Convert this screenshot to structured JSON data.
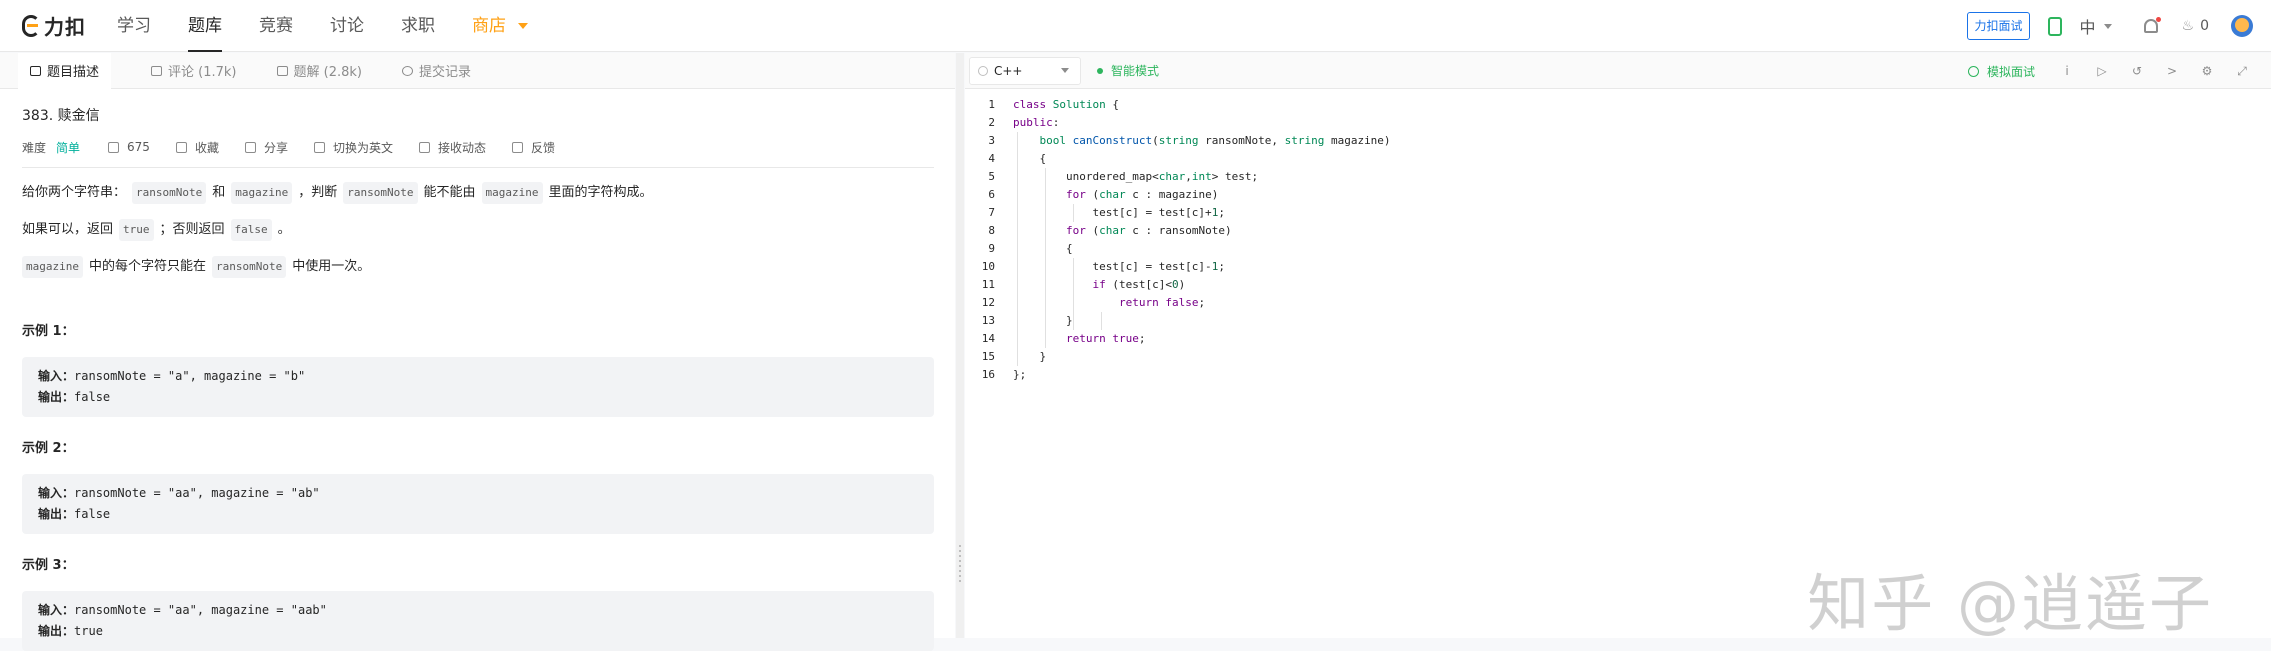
{
  "nav": {
    "logo_text": "力扣",
    "items": [
      "学习",
      "题库",
      "竞赛",
      "讨论",
      "求职"
    ],
    "shop": "商店",
    "interview_button": "力扣面试",
    "language": "中",
    "fire_count": "0"
  },
  "left": {
    "tabs": [
      "题目描述",
      "评论 (1.7k)",
      "题解 (2.8k)",
      "提交记录"
    ],
    "title": "383. 赎金信",
    "difficulty_label": "难度",
    "difficulty": "简单",
    "likes": "675",
    "collect": "收藏",
    "share": "分享",
    "switch_en": "切换为英文",
    "subscribe": "接收动态",
    "feedback": "反馈",
    "desc1": {
      "a": "给你两个字符串：",
      "c1": "ransomNote",
      "b": "和",
      "c2": "magazine",
      "c": "，判断",
      "c3": "ransomNote",
      "d": "能不能由",
      "c4": "magazine",
      "e": "里面的字符构成。"
    },
    "desc2": {
      "a": "如果可以，返回",
      "c1": "true",
      "b": "；否则返回",
      "c2": "false",
      "c": "。"
    },
    "desc3": {
      "c1": "magazine",
      "a": "中的每个字符只能在",
      "c2": "ransomNote",
      "b": "中使用一次。"
    },
    "examples": [
      {
        "title": "示例 1：",
        "in_label": "输入：",
        "input": "ransomNote = \"a\", magazine = \"b\"",
        "out_label": "输出：",
        "output": "false"
      },
      {
        "title": "示例 2：",
        "in_label": "输入：",
        "input": "ransomNote = \"aa\", magazine = \"ab\"",
        "out_label": "输出：",
        "output": "false"
      },
      {
        "title": "示例 3：",
        "in_label": "输入：",
        "input": "ransomNote = \"aa\", magazine = \"aab\"",
        "out_label": "输出：",
        "output": "true"
      }
    ]
  },
  "editor": {
    "language": "C++",
    "smart_mode": "智能模式",
    "mock_interview": "模拟面试",
    "line_numbers": [
      "1",
      "2",
      "3",
      "4",
      "5",
      "6",
      "7",
      "8",
      "9",
      "10",
      "11",
      "12",
      "13",
      "14",
      "15",
      "16"
    ]
  },
  "watermark": "知乎 @逍遥子"
}
